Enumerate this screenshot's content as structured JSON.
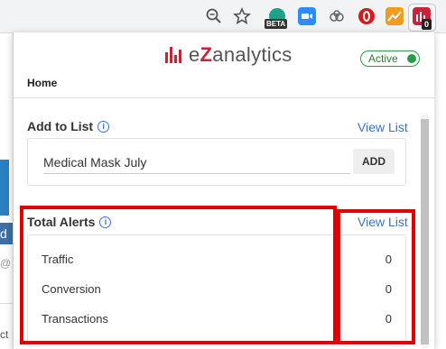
{
  "toolbar": {
    "icons": [
      "zoom-icon",
      "star-icon",
      "beta-extension-icon",
      "zoom-video-icon",
      "cloud-extension-icon",
      "opera-extension-icon",
      "chart-extension-icon",
      "ezanalytics-extension-icon"
    ],
    "beta_badge": "BETA",
    "ez_badge": "0"
  },
  "popup": {
    "logo_prefix": "e",
    "logo_z": "Z",
    "logo_suffix": "analytics",
    "status": "Active",
    "nav_home": "Home",
    "add_to_list": {
      "title": "Add to List",
      "view_link": "View List",
      "input_value": "Medical Mask July",
      "add_button": "ADD"
    },
    "total_alerts": {
      "title": "Total Alerts",
      "view_link": "View List",
      "rows": [
        {
          "name": "Traffic",
          "count": "0"
        },
        {
          "name": "Conversion",
          "count": "0"
        },
        {
          "name": "Transactions",
          "count": "0"
        }
      ]
    }
  },
  "page_peek": {
    "char_d": "d",
    "char_at": "@",
    "char_ct": "ct"
  },
  "colors": {
    "brand": "#c7243a",
    "link": "#3a73c4",
    "active": "#2e9a47",
    "highlight": "#e00000"
  }
}
